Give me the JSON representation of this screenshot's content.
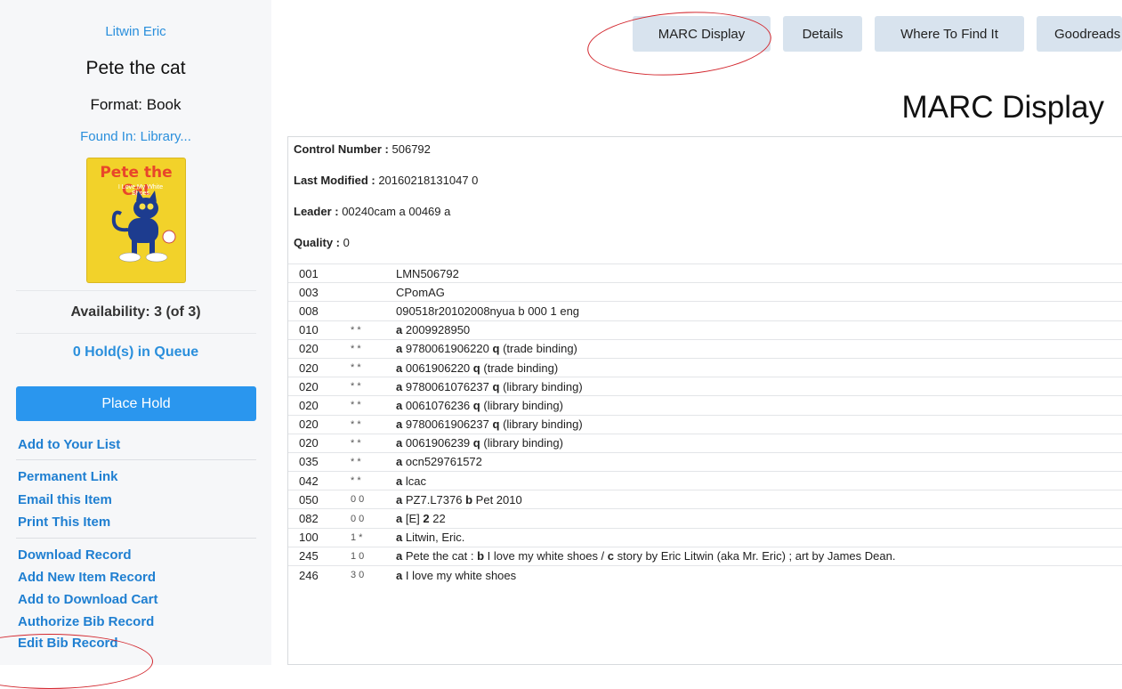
{
  "sidebar": {
    "author": "Litwin Eric",
    "title": "Pete the cat",
    "format": "Format: Book",
    "found_in": "Found In: Library...",
    "cover": {
      "title": "Pete the Cat",
      "subtitle": "I Love My White Shoes"
    },
    "availability": "Availability: 3 (of 3)",
    "holds": "0 Hold(s) in Queue",
    "place_hold": "Place Hold",
    "links": {
      "add_list": "Add to Your List",
      "permanent": "Permanent Link",
      "email": "Email this Item",
      "print": "Print This Item",
      "download": "Download Record",
      "add_item": "Add New Item Record",
      "add_cart": "Add to Download Cart",
      "authorize": "Authorize Bib Record",
      "edit": "Edit Bib Record"
    }
  },
  "nav": {
    "marc": "MARC Display",
    "details": "Details",
    "where": "Where To Find It",
    "goodreads": "Goodreads"
  },
  "main": {
    "heading": "MARC Display",
    "control_label": "Control Number :",
    "control_value": " 506792",
    "modified_label": "Last Modified :",
    "modified_value": " 20160218131047 0",
    "leader_label": "Leader :",
    "leader_value": " 00240cam a 00469 a",
    "quality_label": "Quality :",
    "quality_value": " 0"
  },
  "marc_rows": [
    {
      "tag": "001",
      "ind": "",
      "parts": [
        [
          "",
          "LMN506792"
        ]
      ]
    },
    {
      "tag": "003",
      "ind": "",
      "parts": [
        [
          "",
          "CPomAG"
        ]
      ]
    },
    {
      "tag": "008",
      "ind": "",
      "parts": [
        [
          "",
          "090518r20102008nyua b 000 1 eng"
        ]
      ]
    },
    {
      "tag": "010",
      "ind": "* *",
      "parts": [
        [
          "a",
          "2009928950"
        ]
      ]
    },
    {
      "tag": "020",
      "ind": "* *",
      "parts": [
        [
          "a",
          "9780061906220"
        ],
        [
          "q",
          "(trade binding)"
        ]
      ]
    },
    {
      "tag": "020",
      "ind": "* *",
      "parts": [
        [
          "a",
          "0061906220"
        ],
        [
          "q",
          "(trade binding)"
        ]
      ]
    },
    {
      "tag": "020",
      "ind": "* *",
      "parts": [
        [
          "a",
          "9780061076237"
        ],
        [
          "q",
          "(library binding)"
        ]
      ]
    },
    {
      "tag": "020",
      "ind": "* *",
      "parts": [
        [
          "a",
          "0061076236"
        ],
        [
          "q",
          "(library binding)"
        ]
      ]
    },
    {
      "tag": "020",
      "ind": "* *",
      "parts": [
        [
          "a",
          "9780061906237"
        ],
        [
          "q",
          "(library binding)"
        ]
      ]
    },
    {
      "tag": "020",
      "ind": "* *",
      "parts": [
        [
          "a",
          "0061906239"
        ],
        [
          "q",
          "(library binding)"
        ]
      ]
    },
    {
      "tag": "035",
      "ind": "* *",
      "parts": [
        [
          "a",
          "ocn529761572"
        ]
      ]
    },
    {
      "tag": "042",
      "ind": "* *",
      "parts": [
        [
          "a",
          "lcac"
        ]
      ]
    },
    {
      "tag": "050",
      "ind": "0 0",
      "parts": [
        [
          "a",
          "PZ7.L7376"
        ],
        [
          "b",
          "Pet 2010"
        ]
      ]
    },
    {
      "tag": "082",
      "ind": "0 0",
      "parts": [
        [
          "a",
          "[E]"
        ],
        [
          "2",
          "22"
        ]
      ]
    },
    {
      "tag": "100",
      "ind": "1 *",
      "parts": [
        [
          "a",
          "Litwin, Eric."
        ]
      ]
    },
    {
      "tag": "245",
      "ind": "1 0",
      "parts": [
        [
          "a",
          "Pete the cat :"
        ],
        [
          "b",
          "I love my white shoes /"
        ],
        [
          "c",
          "story by Eric Litwin (aka Mr. Eric) ; art by James Dean."
        ]
      ]
    },
    {
      "tag": "246",
      "ind": "3 0",
      "parts": [
        [
          "a",
          "I love my white shoes"
        ]
      ]
    }
  ],
  "colors": {
    "link": "#1f7fd1",
    "accent": "#2a96ee",
    "annotation": "#d3282f",
    "nav_button": "#d8e3ee"
  }
}
